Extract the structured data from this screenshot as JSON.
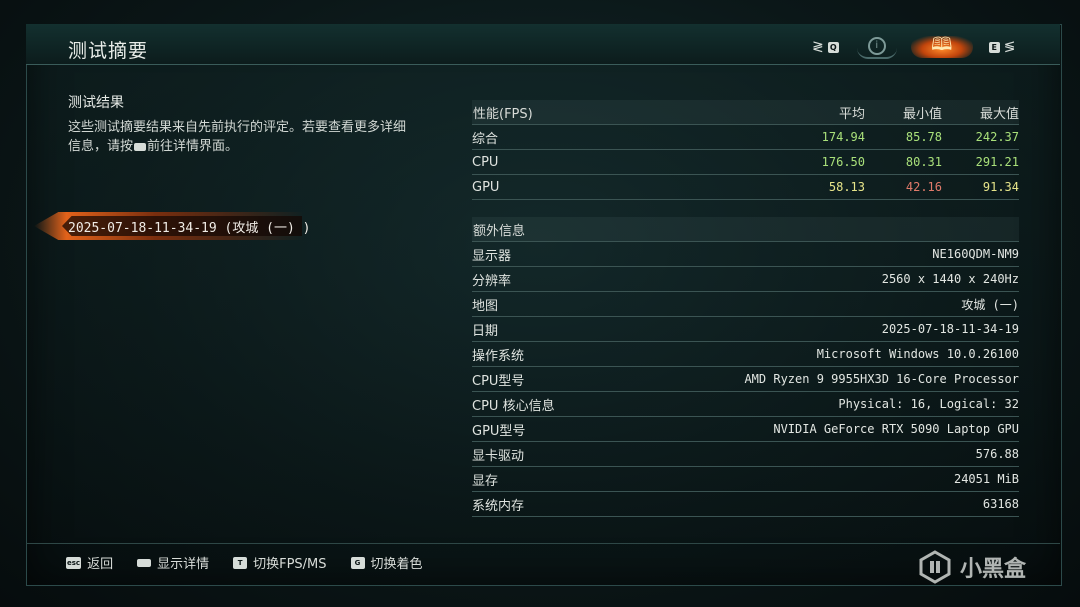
{
  "header": {
    "title": "测试摘要",
    "nav": {
      "left_key": "Q",
      "right_key": "E",
      "icons": [
        "circle-info-icon",
        "book-icon"
      ]
    }
  },
  "left": {
    "title": "测试结果",
    "description_part1": "这些测试摘要结果来自先前执行的评定。若要查看更多详细信息，请按",
    "description_part2": "前往详情界面。",
    "selected_run": "2025-07-18-11-34-19 (攻城 (一) )"
  },
  "performance": {
    "headers": [
      "性能(FPS)",
      "平均",
      "最小值",
      "最大值"
    ],
    "rows": [
      {
        "label": "综合",
        "avg": "174.94",
        "min": "85.78",
        "max": "242.37"
      },
      {
        "label": "CPU",
        "avg": "176.50",
        "min": "80.31",
        "max": "291.21"
      },
      {
        "label": "GPU",
        "avg": "58.13",
        "min": "42.16",
        "max": "91.34"
      }
    ],
    "colors": {
      "green": "#a9e07a",
      "yellow": "#e6e48a",
      "red": "#e07a6a"
    }
  },
  "extra": {
    "header": "额外信息",
    "rows": [
      {
        "label": "显示器",
        "value": "NE160QDM-NM9"
      },
      {
        "label": "分辨率",
        "value": "2560 x 1440 x 240Hz"
      },
      {
        "label": "地图",
        "value": "攻城 (一)"
      },
      {
        "label": "日期",
        "value": "2025-07-18-11-34-19"
      },
      {
        "label": "操作系统",
        "value": "Microsoft Windows 10.0.26100"
      },
      {
        "label": "CPU型号",
        "value": "AMD Ryzen 9 9955HX3D 16-Core Processor"
      },
      {
        "label": "CPU 核心信息",
        "value": "Physical: 16, Logical: 32"
      },
      {
        "label": "GPU型号",
        "value": "NVIDIA GeForce RTX 5090 Laptop GPU"
      },
      {
        "label": "显卡驱动",
        "value": "576.88"
      },
      {
        "label": "显存",
        "value": "24051 MiB"
      },
      {
        "label": "系统内存",
        "value": "63168"
      }
    ]
  },
  "footer": {
    "hints": [
      {
        "key": "esc",
        "label": "返回"
      },
      {
        "key": "",
        "label": "显示详情"
      },
      {
        "key": "T",
        "label": "切换FPS/MS"
      },
      {
        "key": "G",
        "label": "切换着色"
      }
    ],
    "watermark": "小黑盒"
  }
}
